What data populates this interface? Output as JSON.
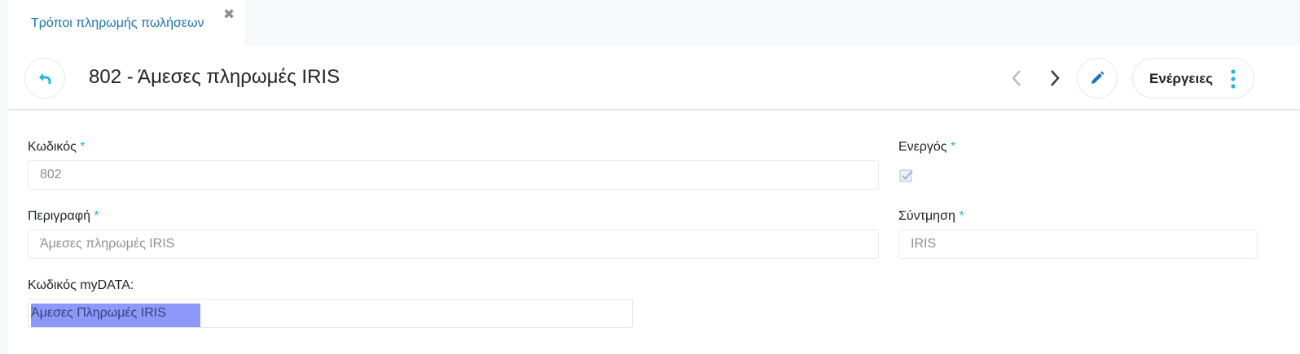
{
  "tab": {
    "label": "Τρόποι πληρωμής πωλήσεων",
    "close_glyph": "✖"
  },
  "header": {
    "title": "802 - Άμεσες πληρωμές IRIS",
    "actions_label": "Ενέργειες"
  },
  "form": {
    "code": {
      "label": "Κωδικός",
      "required": "*",
      "value": "802"
    },
    "active": {
      "label": "Ενεργός",
      "required": "*",
      "checked": true
    },
    "description": {
      "label": "Περιγραφή",
      "required": "*",
      "value": "Άμεσες πληρωμές IRIS"
    },
    "short": {
      "label": "Σύντμηση",
      "required": "*",
      "value": "IRIS"
    },
    "mydata": {
      "label": "Κωδικός myDATA:",
      "value": "Άμεσες Πληρωμές IRIS"
    }
  },
  "colors": {
    "accent": "#27b5d6",
    "link": "#1a73b8",
    "selection": "#8c99fb"
  }
}
